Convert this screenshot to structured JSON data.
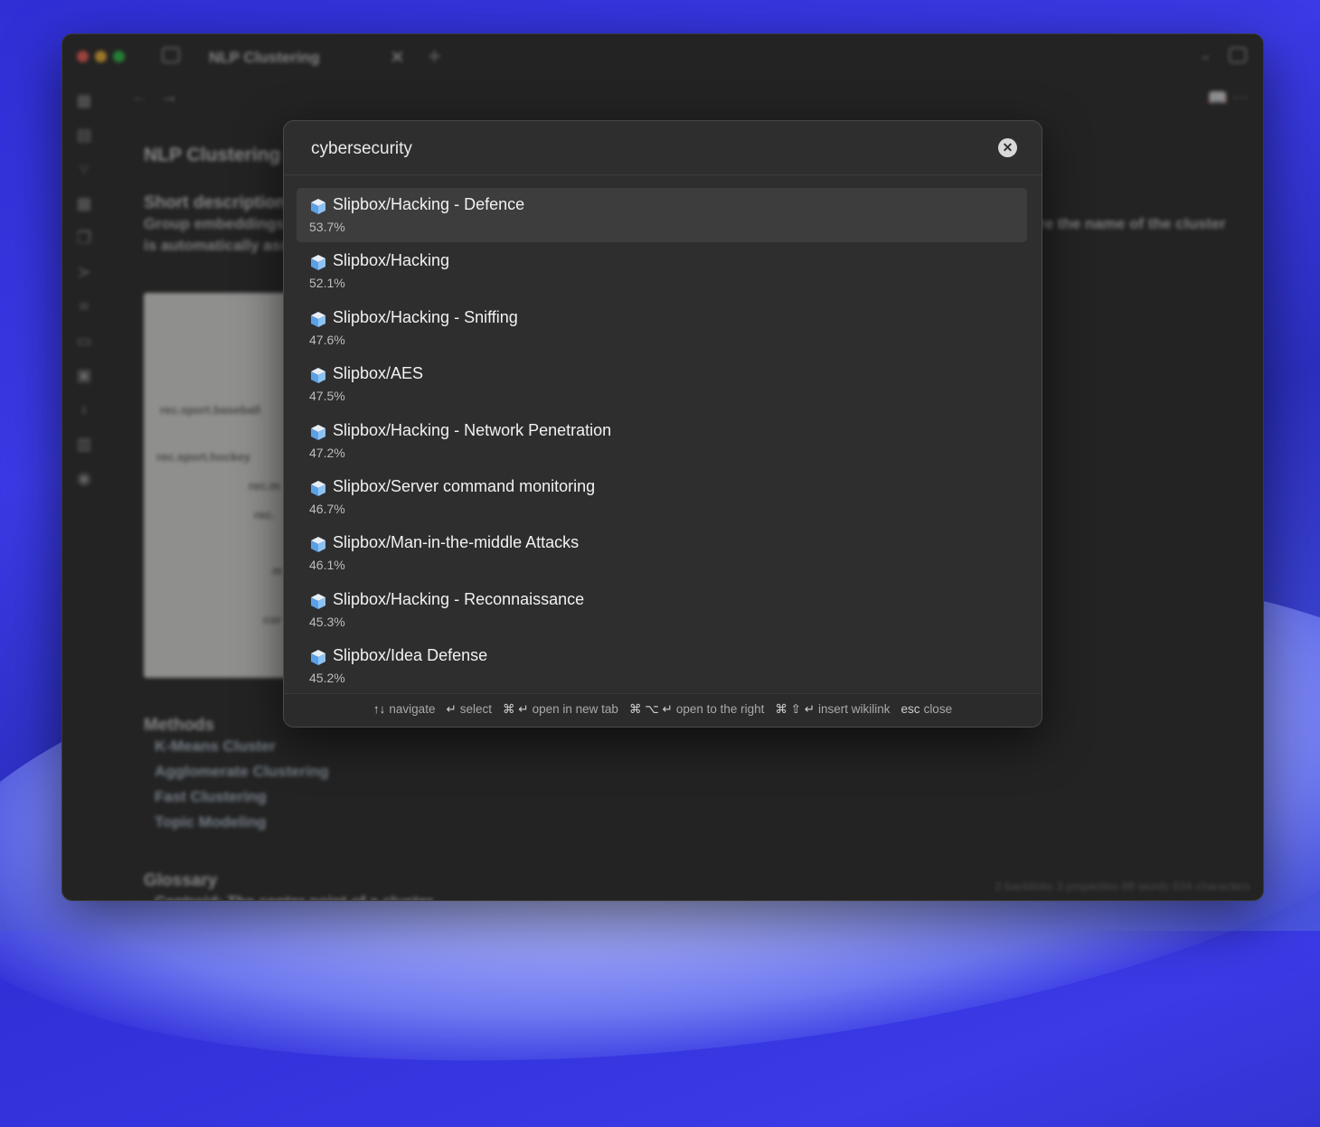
{
  "window": {
    "tab_title": "NLP Clustering",
    "tab_close_glyph": "✕",
    "tab_new_glyph": "+"
  },
  "background_doc": {
    "title": "NLP Clustering",
    "short_description_heading": "Short description",
    "line1": "Group embeddings",
    "line1_right": "re the name of the cluster",
    "line2": "is automatically assi",
    "plot_labels": [
      "rec.sport.baseball",
      "rec.sport.hockey",
      "rec.m",
      "rec.",
      "m",
      "cor"
    ],
    "methods_heading": "Methods",
    "methods": [
      "K-Means Cluster",
      "Agglomerate Clustering",
      "Fast Clustering",
      "Topic Modeling"
    ],
    "glossary_heading": "Glossary",
    "glossary_item": "Centroid: The center point of a cluster",
    "status": "2 backlinks  3 properties  88 words  634 characters"
  },
  "search": {
    "query": "cybersecurity",
    "clear_icon": "close-circle-icon"
  },
  "results": [
    {
      "title": "Slipbox/Hacking - Defence",
      "score": "53.7%",
      "selected": true
    },
    {
      "title": "Slipbox/Hacking",
      "score": "52.1%"
    },
    {
      "title": "Slipbox/Hacking - Sniffing",
      "score": "47.6%"
    },
    {
      "title": "Slipbox/AES",
      "score": "47.5%"
    },
    {
      "title": "Slipbox/Hacking - Network Penetration",
      "score": "47.2%"
    },
    {
      "title": "Slipbox/Server command monitoring",
      "score": "46.7%"
    },
    {
      "title": "Slipbox/Man-in-the-middle Attacks",
      "score": "46.1%"
    },
    {
      "title": "Slipbox/Hacking - Reconnaissance",
      "score": "45.3%"
    },
    {
      "title": "Slipbox/Idea Defense",
      "score": "45.2%"
    }
  ],
  "result_icon": "cube-icon",
  "footer_hints": [
    {
      "keys": "↑↓",
      "label": "navigate"
    },
    {
      "keys": "↵",
      "label": "select"
    },
    {
      "keys": "⌘ ↵",
      "label": "open in new tab"
    },
    {
      "keys": "⌘ ⌥ ↵",
      "label": "open to the right"
    },
    {
      "keys": "⌘ ⇧ ↵",
      "label": "insert wikilink"
    },
    {
      "keys": "esc",
      "label": "close"
    }
  ],
  "colors": {
    "modal_bg": "#2e2e2e",
    "selected_row": "#3d3d3d",
    "wallpaper": "#3a3ae6"
  }
}
